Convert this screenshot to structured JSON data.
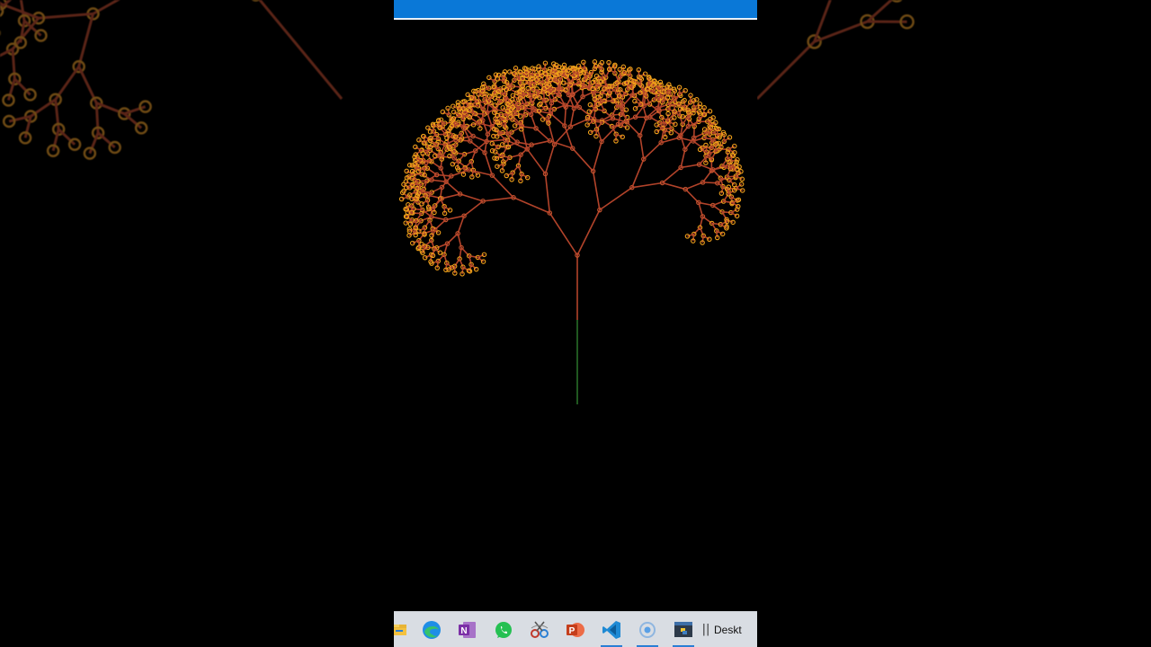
{
  "window": {
    "title": ""
  },
  "taskbar": {
    "apps": [
      {
        "name": "file-explorer",
        "icon": "folder-icon",
        "active": false
      },
      {
        "name": "edge",
        "icon": "edge-icon",
        "active": false
      },
      {
        "name": "onenote",
        "icon": "onenote-icon",
        "active": false
      },
      {
        "name": "whatsapp",
        "icon": "whatsapp-icon",
        "active": false
      },
      {
        "name": "snipping-tool",
        "icon": "snip-icon",
        "active": false
      },
      {
        "name": "powerpoint",
        "icon": "powerpoint-icon",
        "active": false
      },
      {
        "name": "vscode",
        "icon": "vscode-icon",
        "active": true
      },
      {
        "name": "cortana",
        "icon": "circle-icon",
        "active": true
      },
      {
        "name": "python",
        "icon": "python-icon",
        "active": true
      }
    ],
    "separator": "||",
    "label": "Deskt"
  },
  "colors": {
    "titlebar": "#0a78d7",
    "canvas": "#000000",
    "trunk": "#2e7d2e",
    "branch": "#b2432a",
    "leaf": "#f0a01a",
    "taskbar": "#d9dde3"
  }
}
